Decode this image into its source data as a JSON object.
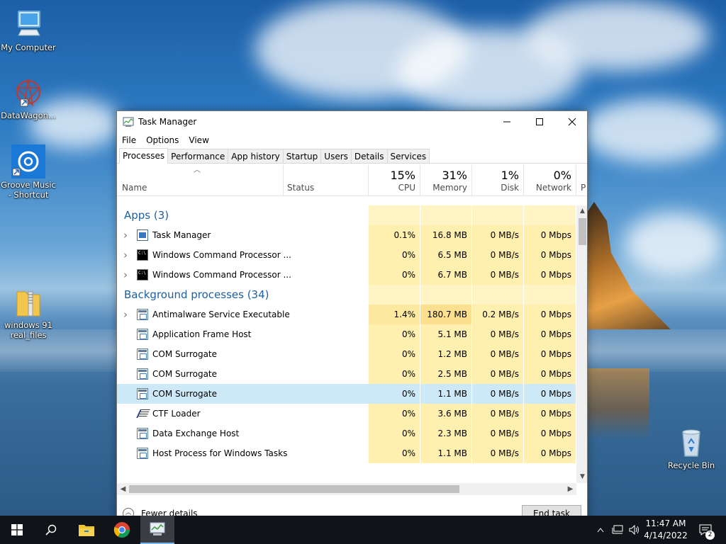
{
  "desktop": {
    "icons": [
      {
        "label": "My Computer",
        "icon": "monitor-icon"
      },
      {
        "label": "DataWagon...",
        "icon": "datawagon-icon"
      },
      {
        "label": "Groove Music - Shortcut",
        "icon": "groove-music-icon"
      },
      {
        "label": "windows 91 real_files",
        "icon": "folder-zip-icon"
      },
      {
        "label": "Recycle Bin",
        "icon": "recycle-bin-icon"
      }
    ]
  },
  "window": {
    "title": "Task Manager",
    "menu": [
      "File",
      "Options",
      "View"
    ],
    "tabs": [
      "Processes",
      "Performance",
      "App history",
      "Startup",
      "Users",
      "Details",
      "Services"
    ],
    "active_tab": "Processes",
    "columns": {
      "name": "Name",
      "status": "Status",
      "cpu": {
        "pct": "15%",
        "label": "CPU"
      },
      "memory": {
        "pct": "31%",
        "label": "Memory"
      },
      "disk": {
        "pct": "1%",
        "label": "Disk"
      },
      "network": {
        "pct": "0%",
        "label": "Network"
      },
      "power_partial": "P"
    },
    "groups": [
      {
        "title": "Apps (3)",
        "rows": [
          {
            "name": "Task Manager",
            "icon": "task-manager-icon",
            "expandable": true,
            "cpu": "0.1%",
            "memory": "16.8 MB",
            "disk": "0 MB/s",
            "network": "0 Mbps"
          },
          {
            "name": "Windows Command Processor ...",
            "icon": "cmd-icon",
            "expandable": true,
            "cpu": "0%",
            "memory": "6.5 MB",
            "disk": "0 MB/s",
            "network": "0 Mbps"
          },
          {
            "name": "Windows Command Processor ...",
            "icon": "cmd-icon",
            "expandable": true,
            "cpu": "0%",
            "memory": "6.7 MB",
            "disk": "0 MB/s",
            "network": "0 Mbps"
          }
        ]
      },
      {
        "title": "Background processes (34)",
        "rows": [
          {
            "name": "Antimalware Service Executable",
            "icon": "process-icon",
            "expandable": true,
            "cpu": "1.4%",
            "memory": "180.7 MB",
            "disk": "0.2 MB/s",
            "network": "0 Mbps"
          },
          {
            "name": "Application Frame Host",
            "icon": "process-icon",
            "expandable": false,
            "cpu": "0%",
            "memory": "5.1 MB",
            "disk": "0 MB/s",
            "network": "0 Mbps"
          },
          {
            "name": "COM Surrogate",
            "icon": "process-icon",
            "expandable": false,
            "cpu": "0%",
            "memory": "1.2 MB",
            "disk": "0 MB/s",
            "network": "0 Mbps"
          },
          {
            "name": "COM Surrogate",
            "icon": "process-icon",
            "expandable": false,
            "cpu": "0%",
            "memory": "2.5 MB",
            "disk": "0 MB/s",
            "network": "0 Mbps"
          },
          {
            "name": "COM Surrogate",
            "icon": "process-icon",
            "expandable": false,
            "cpu": "0%",
            "memory": "1.1 MB",
            "disk": "0 MB/s",
            "network": "0 Mbps",
            "selected": true
          },
          {
            "name": "CTF Loader",
            "icon": "ctf-loader-icon",
            "expandable": false,
            "cpu": "0%",
            "memory": "3.6 MB",
            "disk": "0 MB/s",
            "network": "0 Mbps"
          },
          {
            "name": "Data Exchange Host",
            "icon": "process-icon",
            "expandable": false,
            "cpu": "0%",
            "memory": "2.3 MB",
            "disk": "0 MB/s",
            "network": "0 Mbps"
          },
          {
            "name": "Host Process for Windows Tasks",
            "icon": "process-icon",
            "expandable": false,
            "cpu": "0%",
            "memory": "1.1 MB",
            "disk": "0 MB/s",
            "network": "0 Mbps"
          }
        ]
      }
    ],
    "footer": {
      "fewer_details": "Fewer details",
      "end_task": "End task"
    }
  },
  "taskbar": {
    "apps": [
      "start-icon",
      "search-icon",
      "file-explorer-icon",
      "chrome-icon",
      "task-manager-icon"
    ],
    "clock_time": "11:47 AM",
    "clock_date": "4/14/2022",
    "notification_count": "2"
  },
  "colors": {
    "group_title": "#1e5fa0",
    "heat_light": "#fff4c4",
    "heat_mid": "#fff0b0",
    "selection": "#cde8f7",
    "taskbar": "#101418"
  }
}
